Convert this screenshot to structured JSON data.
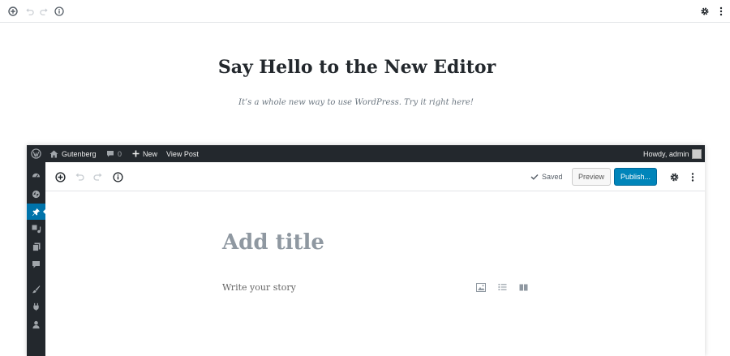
{
  "outer_toolbar": {
    "icons": [
      "add-block-icon",
      "undo-icon",
      "redo-icon",
      "info-icon",
      "gear-icon",
      "more-vertical-icon"
    ]
  },
  "hero": {
    "title": "Say Hello to the New Editor",
    "subtitle": "It’s a whole new way to use WordPress. Try it right here!"
  },
  "admin_bar": {
    "site_name": "Gutenberg",
    "comments_count": "0",
    "new_label": "New",
    "view_post_label": "View Post",
    "greeting": "Howdy, admin"
  },
  "editor": {
    "saved_label": "Saved",
    "preview_label": "Preview",
    "publish_label": "Publish...",
    "title_placeholder": "Add title",
    "body_placeholder": "Write your story"
  },
  "colors": {
    "admin_bar_bg": "#23282d",
    "accent": "#0085ba",
    "active_menu": "#0073aa"
  }
}
